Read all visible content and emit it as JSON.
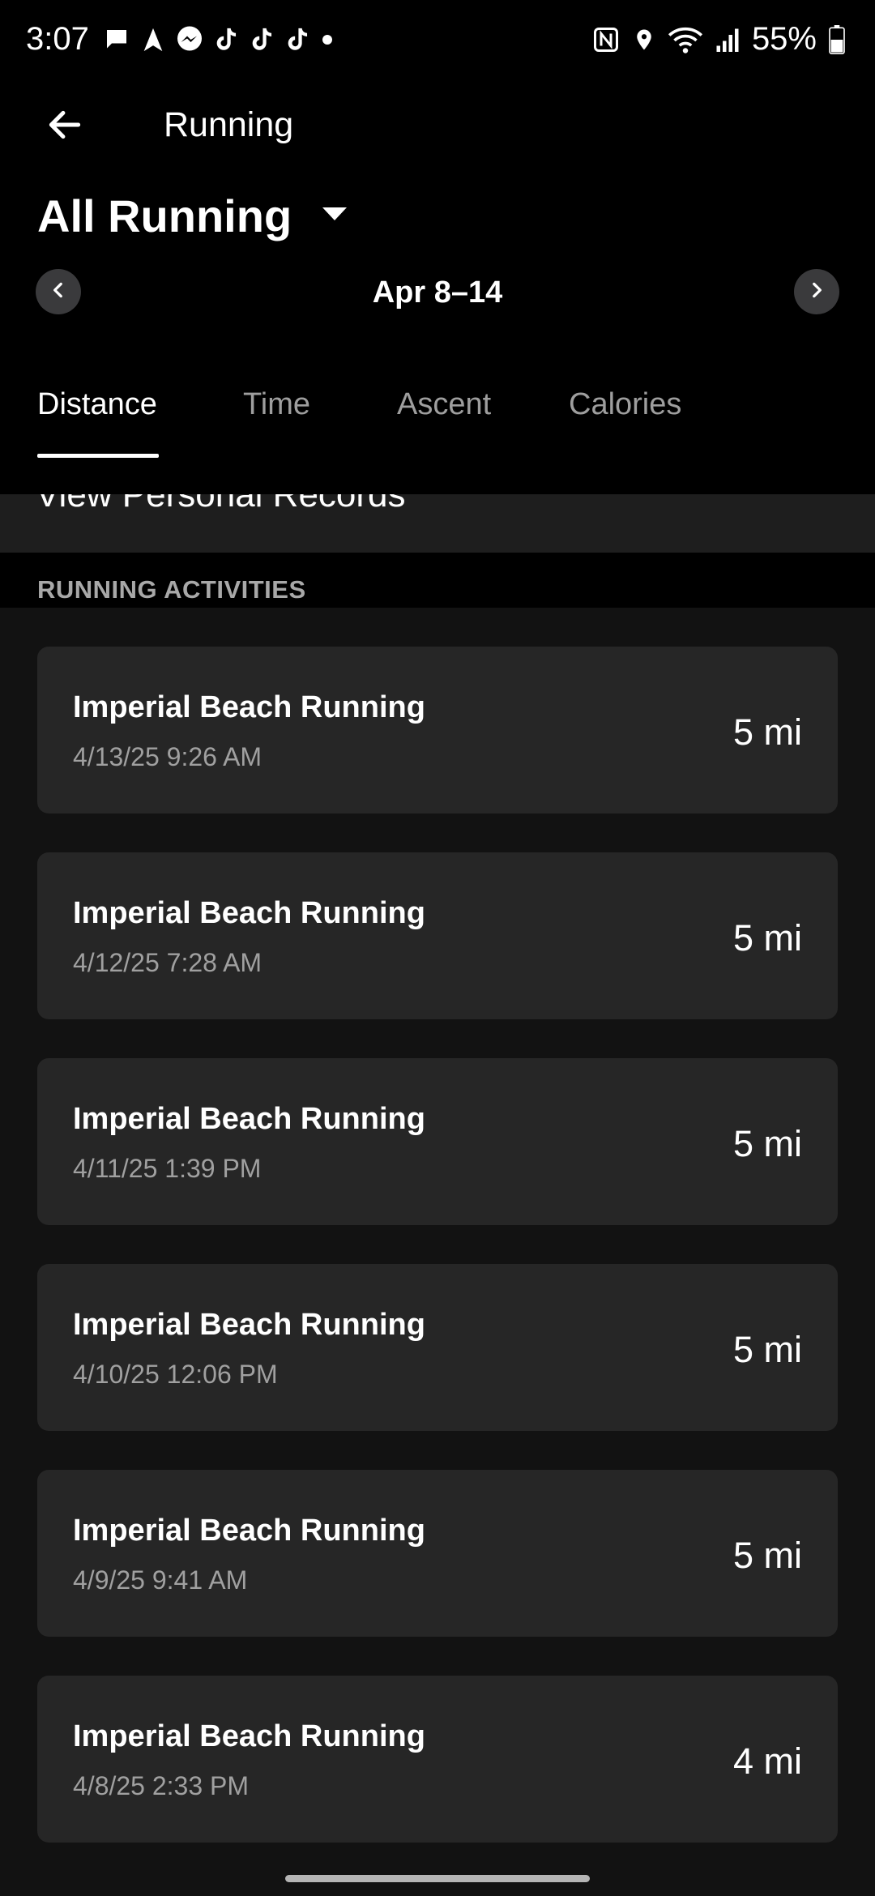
{
  "status_bar": {
    "time": "3:07",
    "battery": "55%",
    "notification_icons": [
      "chat-icon",
      "navigation-icon",
      "messenger-icon",
      "tiktok-icon",
      "tiktok-icon",
      "tiktok-icon",
      "dot-icon"
    ],
    "system_icons": [
      "nfc-icon",
      "location-icon",
      "wifi-icon",
      "signal-icon",
      "battery-icon"
    ]
  },
  "header": {
    "title": "Running",
    "back_icon": "arrow-left-icon"
  },
  "filter": {
    "label": "All Running",
    "icon": "caret-down-icon"
  },
  "date_range": {
    "label": "Apr 8–14",
    "prev_icon": "chevron-left-icon",
    "next_icon": "chevron-right-icon"
  },
  "tabs": [
    {
      "label": "Distance",
      "active": true
    },
    {
      "label": "Time",
      "active": false
    },
    {
      "label": "Ascent",
      "active": false
    },
    {
      "label": "Calories",
      "active": false
    }
  ],
  "records": {
    "label": "View Personal Records"
  },
  "activities_section": {
    "title": "RUNNING ACTIVITIES",
    "items": [
      {
        "name": "Imperial Beach Running",
        "datetime": "4/13/25 9:26 AM",
        "distance": "5 mi"
      },
      {
        "name": "Imperial Beach Running",
        "datetime": "4/12/25 7:28 AM",
        "distance": "5 mi"
      },
      {
        "name": "Imperial Beach Running",
        "datetime": "4/11/25 1:39 PM",
        "distance": "5 mi"
      },
      {
        "name": "Imperial Beach Running",
        "datetime": "4/10/25 12:06 PM",
        "distance": "5 mi"
      },
      {
        "name": "Imperial Beach Running",
        "datetime": "4/9/25 9:41 AM",
        "distance": "5 mi"
      },
      {
        "name": "Imperial Beach Running",
        "datetime": "4/8/25 2:33 PM",
        "distance": "4 mi"
      }
    ]
  },
  "colors": {
    "background": "#121212",
    "header_background": "#000000",
    "card_background": "#262626",
    "muted_text": "#a0a0a0",
    "inactive_tab": "#9e9e9e"
  }
}
